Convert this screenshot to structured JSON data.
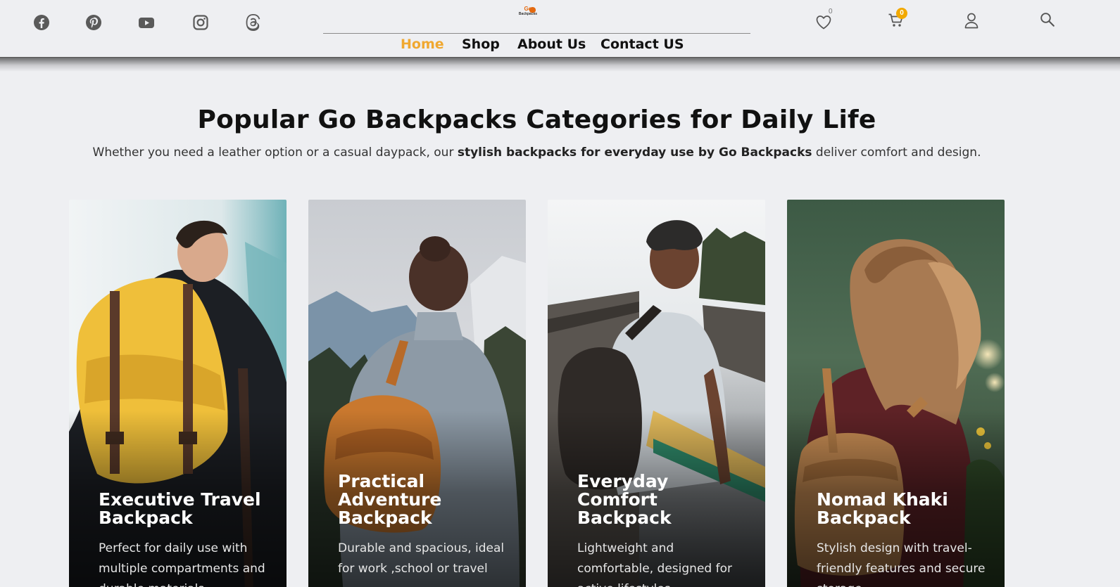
{
  "header": {
    "social_icons": [
      "facebook-icon",
      "pinterest-icon",
      "youtube-icon",
      "instagram-icon",
      "threads-icon"
    ],
    "logo": {
      "line1": "Go",
      "line2": "Backpacks"
    },
    "nav": [
      {
        "label": "Home",
        "active": true
      },
      {
        "label": "Shop",
        "active": false
      },
      {
        "label": "About Us",
        "active": false
      },
      {
        "label": "Contact US",
        "active": false
      }
    ],
    "wishlist_count": "0",
    "cart_count": "0",
    "accent_color": "#f0a830",
    "cart_badge_color": "#f2a900"
  },
  "section": {
    "title": "Popular Go Backpacks Categories for Daily Life",
    "subtitle_pre": "Whether you need a leather option or a casual daypack, our ",
    "subtitle_bold": "stylish backpacks for everyday use by Go Backpacks",
    "subtitle_post": " deliver comfort and design."
  },
  "cards": [
    {
      "title": "Executive Travel Backpack",
      "description": "Perfect for daily use with multiple compartments and durable materials"
    },
    {
      "title": "Practical Adventure Backpack",
      "description": "Durable and spacious, ideal for work ,school or travel"
    },
    {
      "title": "Everyday Comfort Backpack",
      "description": "Lightweight and comfortable, designed for active lifestyles"
    },
    {
      "title": "Nomad Khaki Backpack",
      "description": "Stylish design with travel-friendly features and secure storage"
    }
  ]
}
